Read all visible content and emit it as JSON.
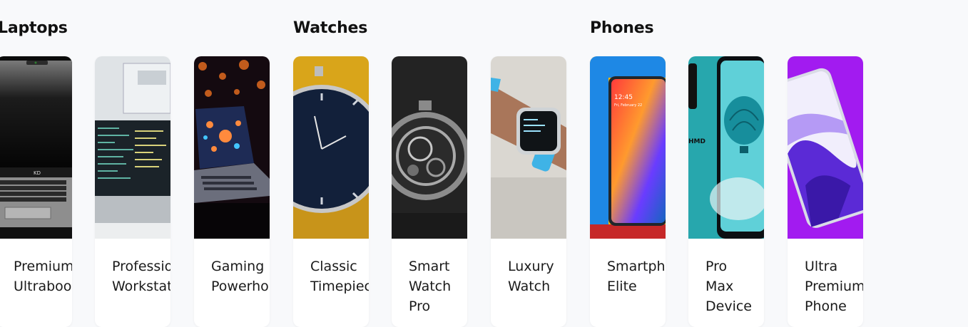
{
  "sections": [
    {
      "title": "Laptops",
      "products": [
        {
          "name": "Premium\nUltrabook",
          "image": "laptop-black-image"
        },
        {
          "name": "Professional\nWorkstation",
          "image": "laptop-code-image"
        },
        {
          "name": "Gaming\nPowerhouse",
          "image": "laptop-gaming-image"
        }
      ]
    },
    {
      "title": "Watches",
      "products": [
        {
          "name": "Classic\nTimepiece",
          "image": "watch-classic-image"
        },
        {
          "name": "Smart\nWatch\nPro",
          "image": "watch-skeleton-image"
        },
        {
          "name": "Luxury\nWatch",
          "image": "watch-smart-image"
        }
      ]
    },
    {
      "title": "Phones",
      "products": [
        {
          "name": "Smartphone\nElite",
          "image": "phone-samsung-image"
        },
        {
          "name": "Pro\nMax\nDevice",
          "image": "phone-teal-image"
        },
        {
          "name": "Ultra\nPremium\nPhone",
          "image": "phone-purple-image"
        }
      ]
    }
  ]
}
